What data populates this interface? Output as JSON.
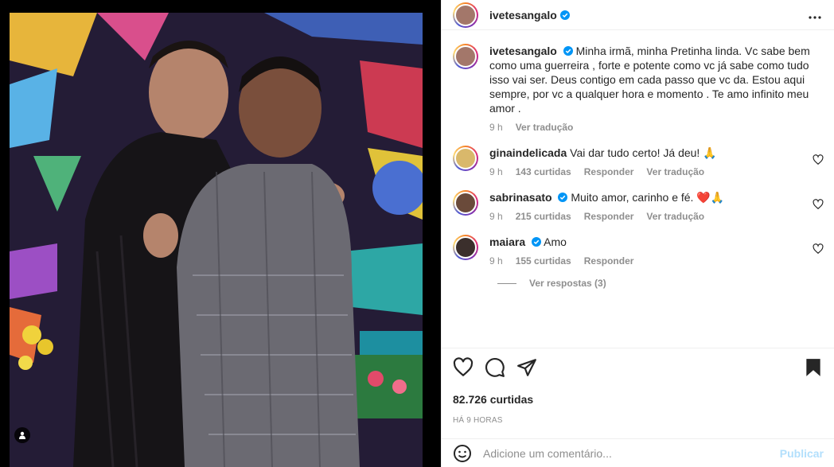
{
  "post": {
    "author": "ivetesangalo",
    "more_icon": "more-horizontal-icon"
  },
  "caption": {
    "user": "ivetesangalo",
    "text": "Minha irmã, minha Pretinha linda. Vc sabe bem como uma guerreira , forte e potente como vc já sabe como tudo isso vai ser. Deus contigo em cada passo que vc da. Estou aqui sempre, por vc a qualquer hora e momento . Te amo infinito meu amor .",
    "time": "9 h",
    "translate": "Ver tradução"
  },
  "comments": [
    {
      "user": "ginaindelicada",
      "text": "Vai dar tudo certo! Já deu! 🙏",
      "time": "9 h",
      "likes": "143 curtidas",
      "reply": "Responder",
      "translate": "Ver tradução"
    },
    {
      "user": "sabrinasato",
      "text": "Muito amor, carinho e fé. ❤️🙏",
      "time": "9 h",
      "likes": "215 curtidas",
      "reply": "Responder",
      "translate": "Ver tradução"
    },
    {
      "user": "maiara",
      "text": "Amo",
      "time": "9 h",
      "likes": "155 curtidas",
      "reply": "Responder"
    }
  ],
  "view_replies": "Ver respostas (3)",
  "likes_count": "82.726 curtidas",
  "timestamp": "HÁ 9 HORAS",
  "add_comment": {
    "placeholder": "Adicione um comentário...",
    "post_label": "Publicar"
  },
  "colors": {
    "verified": "#0095f6",
    "link_disabled": "#b2dffc",
    "secondary_text": "#8e8e8e",
    "heart_red": "#ed4956"
  }
}
